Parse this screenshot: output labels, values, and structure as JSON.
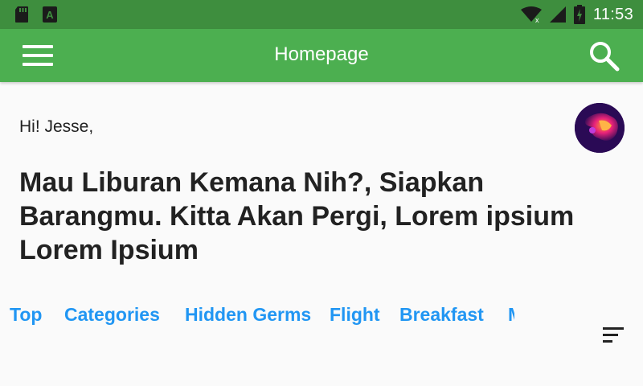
{
  "status_bar": {
    "time": "11:53",
    "icons": [
      "sd-card-icon",
      "app-notification-icon",
      "wifi-icon",
      "signal-icon",
      "battery-icon"
    ]
  },
  "app_bar": {
    "title": "Homepage",
    "color": "#4caf50",
    "status_color": "#3e8e3e",
    "menu_icon": "hamburger-menu-icon",
    "search_icon": "search-icon"
  },
  "content": {
    "greeting": "Hi! Jesse,",
    "headline": "Mau Liburan Kemana Nih?, Siapkan Barangmu. Kitta Akan Pergi, Lorem ipsium Lorem Ipsium"
  },
  "tabs": [
    {
      "label": "Top"
    },
    {
      "label": "Categories"
    },
    {
      "label": "Hidden Germs"
    },
    {
      "label": "Flight"
    },
    {
      "label": "Breakfast"
    },
    {
      "label": "M"
    }
  ],
  "tab_color": "#2196f3",
  "filter_icon": "sort-filter-icon"
}
